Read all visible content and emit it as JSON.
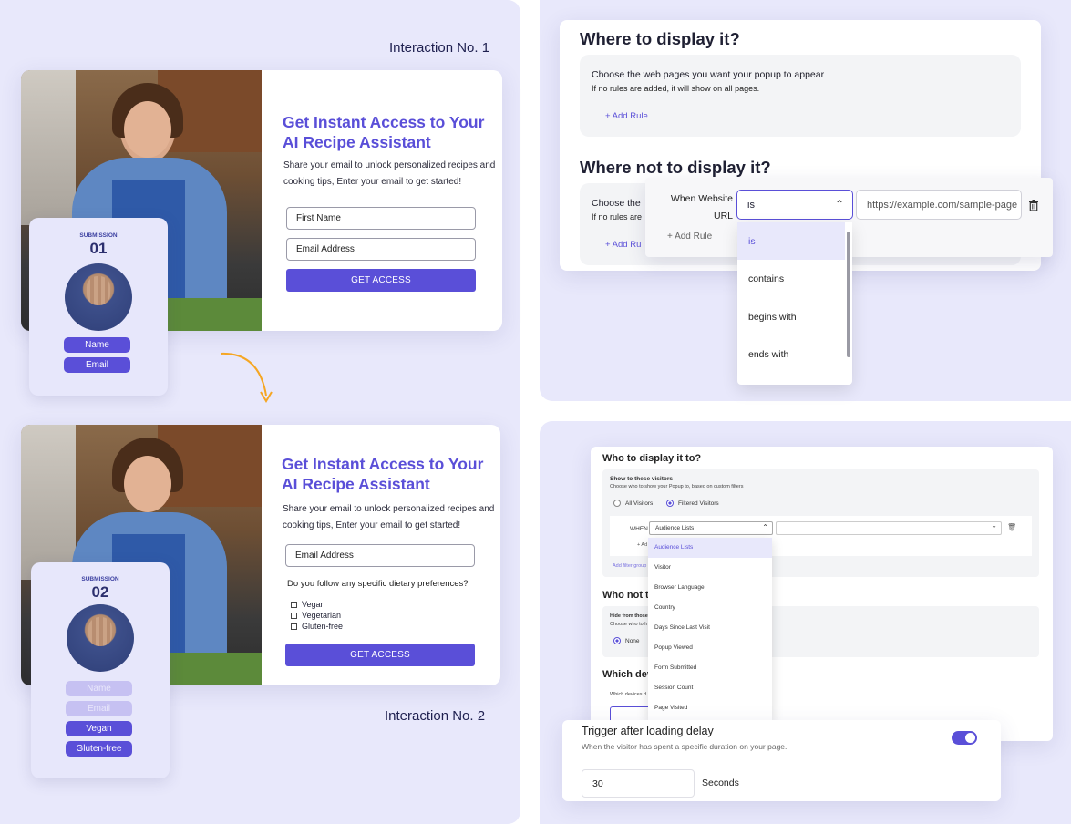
{
  "labels": {
    "interaction1": "Interaction No. 1",
    "interaction2": "Interaction No. 2"
  },
  "form1": {
    "title_line1": "Get Instant Access to Your",
    "title_line2": "AI Recipe Assistant",
    "desc_line1": "Share your email to unlock personalized recipes and",
    "desc_line2": "cooking tips, Enter your email to get started!",
    "first_name_placeholder": "First Name",
    "email_placeholder": "Email Address",
    "button": "GET ACCESS"
  },
  "form2": {
    "title_line1": "Get Instant Access to Your",
    "title_line2": "AI Recipe Assistant",
    "desc_line1": "Share your email to unlock personalized recipes and",
    "desc_line2": "cooking tips, Enter your email to get started!",
    "email_placeholder": "Email Address",
    "question": "Do you follow any specific dietary preferences?",
    "options": [
      "Vegan",
      "Vegetarian",
      "Gluten-free"
    ],
    "button": "GET ACCESS"
  },
  "submission1": {
    "label": "SUBMISSION",
    "number": "01",
    "pills": [
      "Name",
      "Email"
    ]
  },
  "submission2": {
    "label": "SUBMISSION",
    "number": "02",
    "pills": [
      "Name",
      "Email",
      "Vegan",
      "Gluten-free"
    ]
  },
  "display": {
    "where_title": "Where to display it?",
    "where_box_title": "Choose the web pages you want your popup to appear",
    "where_box_sub": "If no rules are added, it will show on all pages.",
    "add_rule": "+ Add Rule",
    "where_not_title": "Where not to display it?",
    "where_not_box_title": "Choose the",
    "where_not_box_sub": "If no rules are",
    "where_not_add_rule": "+ Add Ru",
    "rule_label_line1": "When Website",
    "rule_label_line2": "URL",
    "rule_add": "+ Add Rule",
    "select_value": "is",
    "url_placeholder": "https://example.com/sample-page",
    "dropdown_options": [
      "is",
      "contains",
      "begins with",
      "ends with"
    ]
  },
  "targeting": {
    "who_title": "Who to display it to?",
    "show_title": "Show to these visitors",
    "show_sub": "Choose who to show your Popup to, based on custom filters",
    "radio_all": "All Visitors",
    "radio_filtered": "Filtered Visitors",
    "when": "WHEN",
    "select_value": "Audience Lists",
    "add_small": "+ Ad",
    "add_filter_group": "Add filter group",
    "who_not_title": "Who not to",
    "hide_title": "Hide from those",
    "hide_sub": "Choose who to h",
    "none": "None",
    "which_dev": "Which dev",
    "which_dev_sub": "Which devices d",
    "dropdown": [
      "Audience Lists",
      "Visitor",
      "Browser Language",
      "Country",
      "Days Since Last Visit",
      "Popup Viewed",
      "Form Submitted",
      "Session Count",
      "Page Visited"
    ]
  },
  "trigger": {
    "title": "Trigger after loading delay",
    "sub": "When the visitor has spent a specific duration on your page.",
    "value": "30",
    "unit": "Seconds",
    "toggle_on": true
  },
  "colors": {
    "accent": "#5a4fd8",
    "panel": "#e8e8fb",
    "arrow": "#f5a623"
  }
}
